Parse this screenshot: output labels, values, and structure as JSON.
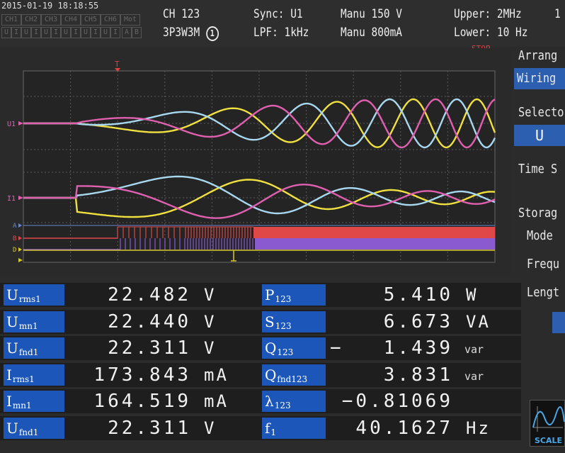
{
  "header": {
    "datetime": "2015-01-19 18:18:55",
    "channels": [
      "CH1",
      "CH2",
      "CH3",
      "CH4",
      "CH5",
      "CH6",
      "Mot"
    ],
    "ui_flags": [
      "U",
      "I",
      "U",
      "I",
      "U",
      "I",
      "U",
      "I",
      "U",
      "I",
      "U",
      "I",
      "A",
      "B"
    ],
    "channel_group": "CH 123",
    "wiring": "3P3W3M",
    "wiring_badge": "1",
    "sync": "Sync: U1",
    "lpf": "LPF: 1kHz",
    "range_u": "Manu 150 V",
    "range_i": "Manu 800mA",
    "upper": "Upper: 2MHz",
    "lower": "Lower: 10 Hz",
    "extra": "1",
    "status": "STOP"
  },
  "waveform": {
    "trigger_marker": "T",
    "trace_labels": [
      "U1",
      "I1",
      "A",
      "B",
      "D"
    ]
  },
  "side_panel": {
    "arrange_label": "Arrang",
    "wiring_button": "Wiring",
    "selector_label": "Selecto",
    "selector_value": "U",
    "time_label": "Time S",
    "storage_label": "Storag",
    "mode_label": "Mode",
    "freq_label": "Frequ",
    "length_label": "Lengt",
    "scale_label": "SCALE"
  },
  "measurements_left": [
    {
      "label": "U",
      "sub": "rms1",
      "value": "22.482",
      "unit": "V"
    },
    {
      "label": "U",
      "sub": "mn1",
      "value": "22.440",
      "unit": "V"
    },
    {
      "label": "U",
      "sub": "fnd1",
      "value": "22.311",
      "unit": "V"
    },
    {
      "label": "I",
      "sub": "rms1",
      "value": "173.843",
      "unit": "mA"
    },
    {
      "label": "I",
      "sub": "mn1",
      "value": "164.519",
      "unit": "mA"
    },
    {
      "label": "U",
      "sub": "fnd1",
      "value": "22.311",
      "unit": "V"
    }
  ],
  "measurements_right": [
    {
      "label": "P",
      "sub": "123",
      "value": "5.410",
      "unit": "W"
    },
    {
      "label": "S",
      "sub": "123",
      "value": "6.673",
      "unit": "VA"
    },
    {
      "label": "Q",
      "sub": "123",
      "sign": "−",
      "value": "1.439",
      "unit": "var"
    },
    {
      "label": "Q",
      "sub": "fnd123",
      "value": "3.831",
      "unit": "var"
    },
    {
      "label": "λ",
      "sub": "123",
      "value": "−0.81069",
      "unit": ""
    },
    {
      "label": "f",
      "sub": "1",
      "value": "40.1627",
      "unit": "Hz"
    }
  ],
  "colors": {
    "u1_wave": "#f0e040",
    "u2_wave": "#a8d8f0",
    "u3_wave": "#e060b0",
    "label_bg": "#1c56b8",
    "digital_a": "#e04848",
    "digital_b": "#8a5ad0",
    "digital_d": "#d8c830"
  }
}
